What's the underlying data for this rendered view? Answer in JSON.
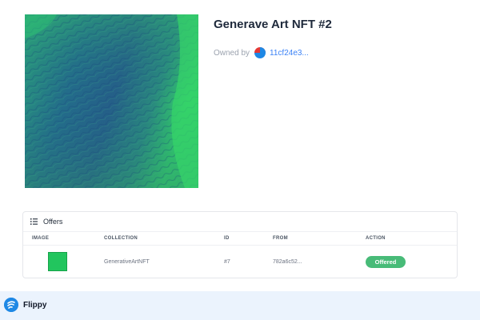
{
  "nft": {
    "title": "Generave Art NFT #2",
    "owned_by_label": "Owned by",
    "owner_id": "11cf24e3..."
  },
  "offers": {
    "section_title": "Offers",
    "columns": {
      "image": "IMAGE",
      "collection": "COLLECTION",
      "id": "ID",
      "from": "FROM",
      "action": "ACTION"
    },
    "rows": [
      {
        "collection": "GenerativeArtNFT",
        "id": "#7",
        "from": "782a6c52...",
        "action": "Offered",
        "thumb_color": "#22c55e"
      }
    ]
  },
  "footer": {
    "brand": "Flippy"
  },
  "colors": {
    "accent_green": "#48bb78",
    "link_blue": "#3b82f6",
    "art_dark": "#1f5f8a",
    "art_light": "#2ed36a"
  }
}
